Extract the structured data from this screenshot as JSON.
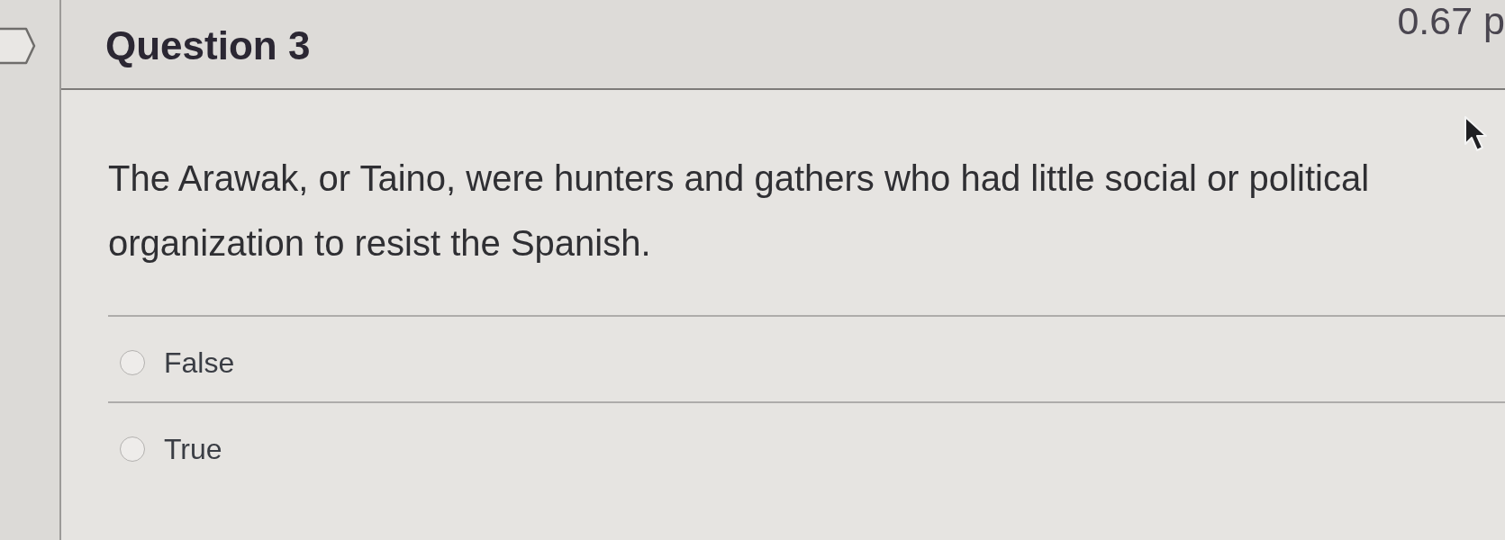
{
  "header": {
    "title": "Question 3",
    "points": "0.67 p"
  },
  "question": {
    "text": "The Arawak, or Taino, were hunters and gathers who had little social or political organization to resist the Spanish."
  },
  "answers": [
    {
      "label": "False",
      "selected": false
    },
    {
      "label": "True",
      "selected": false
    }
  ]
}
